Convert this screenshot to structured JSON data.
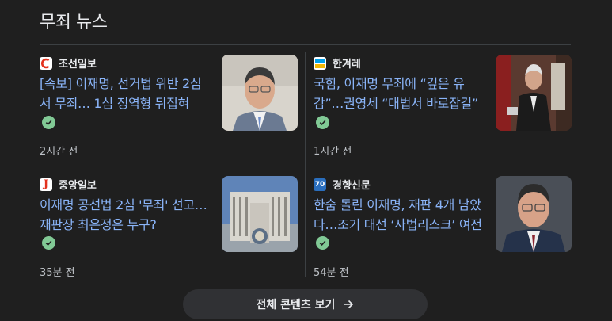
{
  "section": {
    "title": "무죄 뉴스"
  },
  "articles": [
    {
      "source": "조선일보",
      "headline": "[속보] 이재명, 선거법 위반 2심서 무죄… 1심 징역형 뒤집혀",
      "time": "2시간 전",
      "logo_color": "#e3311d",
      "thumb_icon": "person-photo"
    },
    {
      "source": "한겨레",
      "headline": "국힘, 이재명 무죄에 “깊은 유감”…권영세 “대법서 바로잡길”",
      "time": "1시간 전",
      "logo_color": "#00a0e9",
      "thumb_icon": "person-photo"
    },
    {
      "source": "중앙일보",
      "headline": "이재명 공선법 2심 '무죄' 선고…재판장 최은정은 누구?",
      "time": "35분 전",
      "logo_color": "#e3311d",
      "thumb_icon": "building-photo"
    },
    {
      "source": "경향신문",
      "headline": "한숨 돌린 이재명, 재판 4개 남았다…조기 대선 ‘사법리스크’ 여전",
      "time": "54분 전",
      "logo_color": "#2a6ebd",
      "thumb_icon": "person-photo"
    }
  ],
  "more_button": {
    "label": "전체 콘텐츠 보기"
  },
  "colors": {
    "link": "#8ab4f8",
    "verified": "#81c995",
    "background": "#1f1f1f"
  }
}
